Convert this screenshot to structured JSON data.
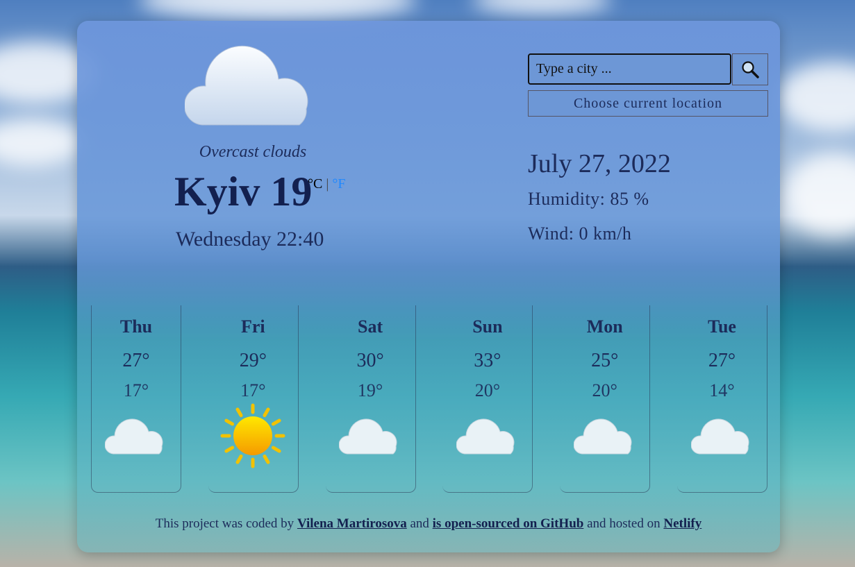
{
  "current": {
    "description": "Overcast clouds",
    "city": "Kyiv",
    "temperature": "19",
    "unit_c": "°C",
    "unit_sep": "|",
    "unit_f": "°F",
    "datetime": "Wednesday 22:40",
    "icon": "cloud-icon"
  },
  "search": {
    "placeholder": "Type a city ...",
    "button_icon": "search-icon",
    "location_button": "Choose current location"
  },
  "details": {
    "date": "July 27, 2022",
    "humidity": "Humidity:  85 %",
    "wind": "Wind:  0  km/h"
  },
  "forecast": [
    {
      "day": "Thu",
      "high": "27°",
      "low": "17°",
      "icon": "cloud-icon"
    },
    {
      "day": "Fri",
      "high": "29°",
      "low": "17°",
      "icon": "sun-icon"
    },
    {
      "day": "Sat",
      "high": "30°",
      "low": "19°",
      "icon": "cloud-icon"
    },
    {
      "day": "Sun",
      "high": "33°",
      "low": "20°",
      "icon": "cloud-icon"
    },
    {
      "day": "Mon",
      "high": "25°",
      "low": "20°",
      "icon": "cloud-icon"
    },
    {
      "day": "Tue",
      "high": "27°",
      "low": "14°",
      "icon": "cloud-icon"
    }
  ],
  "footer": {
    "t1": "This project was coded by ",
    "author": "Vilena Martirosova",
    "t2": " and ",
    "github": "is open-sourced on GitHub",
    "t3": " and hosted on ",
    "netlify": "Netlify"
  }
}
